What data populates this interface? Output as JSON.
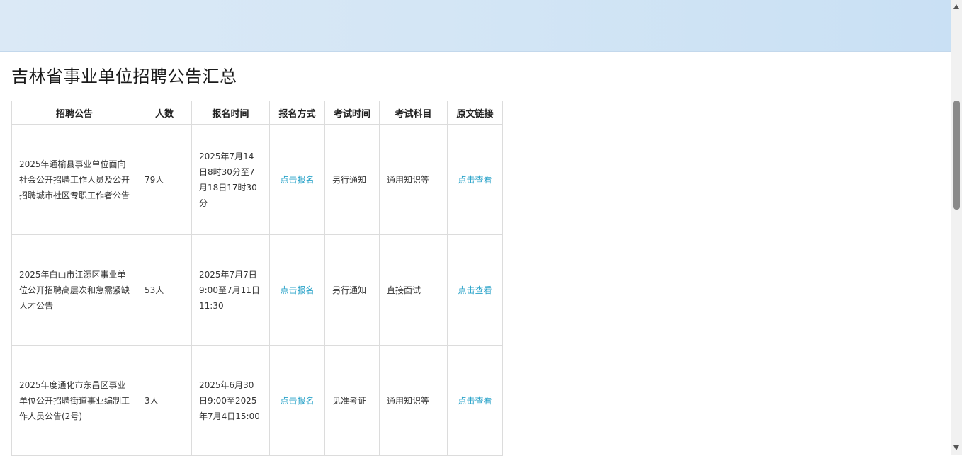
{
  "page_title": "吉林省事业单位招聘公告汇总",
  "table": {
    "headers": {
      "notice": "招聘公告",
      "count": "人数",
      "signup_time": "报名时间",
      "signup_method": "报名方式",
      "exam_time": "考试时间",
      "exam_subject": "考试科目",
      "link": "原文链接"
    },
    "rows": [
      {
        "notice": "2025年通榆县事业单位面向社会公开招聘工作人员及公开招聘城市社区专职工作者公告",
        "count": "79人",
        "signup_time": "2025年7月14日8时30分至7月18日17时30分",
        "signup_method": "点击报名",
        "exam_time": "另行通知",
        "exam_subject": "通用知识等",
        "link": "点击查看"
      },
      {
        "notice": "2025年白山市江源区事业单位公开招聘高层次和急需紧缺人才公告",
        "count": "53人",
        "signup_time": "2025年7月7日9:00至7月11日11:30",
        "signup_method": "点击报名",
        "exam_time": "另行通知",
        "exam_subject": "直接面试",
        "link": "点击查看"
      },
      {
        "notice": "2025年度通化市东昌区事业单位公开招聘街道事业编制工作人员公告(2号)",
        "count": "3人",
        "signup_time": "2025年6月30日9:00至2025年7月4日15:00",
        "signup_method": "点击报名",
        "exam_time": "见准考证",
        "exam_subject": "通用知识等",
        "link": "点击查看"
      }
    ]
  }
}
